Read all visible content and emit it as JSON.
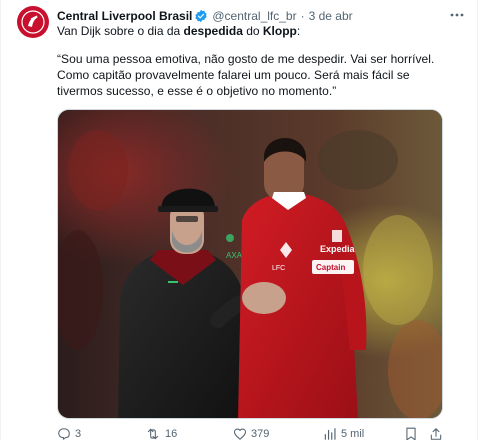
{
  "account": {
    "display_name": "Central Liverpool Brasil",
    "handle": "@central_lfc_br",
    "separator": "·",
    "time": "3 de abr"
  },
  "text": {
    "intro_before": "Van Dijk sobre o dia da ",
    "intro_bold1": "despedida",
    "intro_middle": " do ",
    "intro_bold2": "Klopp",
    "intro_after": ":",
    "quote": "“Sou uma pessoa emotiva, não gosto de me despedir. Vai ser horrível. Como capitão provavelmente falarei um pouco. Será mais fácil se tivermos sucesso, e esse é o objetivo no momento.”"
  },
  "media": {
    "sponsor": "Expedia",
    "armband": "Captain",
    "crest": "LFC",
    "jacket_logo": "AXA"
  },
  "actions": {
    "replies": "3",
    "reposts": "16",
    "likes": "379",
    "views": "5 mil"
  },
  "colors": {
    "brand_red": "#c8102e",
    "verified_blue": "#1d9bf0",
    "muted": "#536471"
  },
  "icons": [
    "more-icon",
    "verified-icon",
    "reply-icon",
    "repost-icon",
    "like-icon",
    "views-icon",
    "bookmark-icon",
    "share-icon"
  ]
}
